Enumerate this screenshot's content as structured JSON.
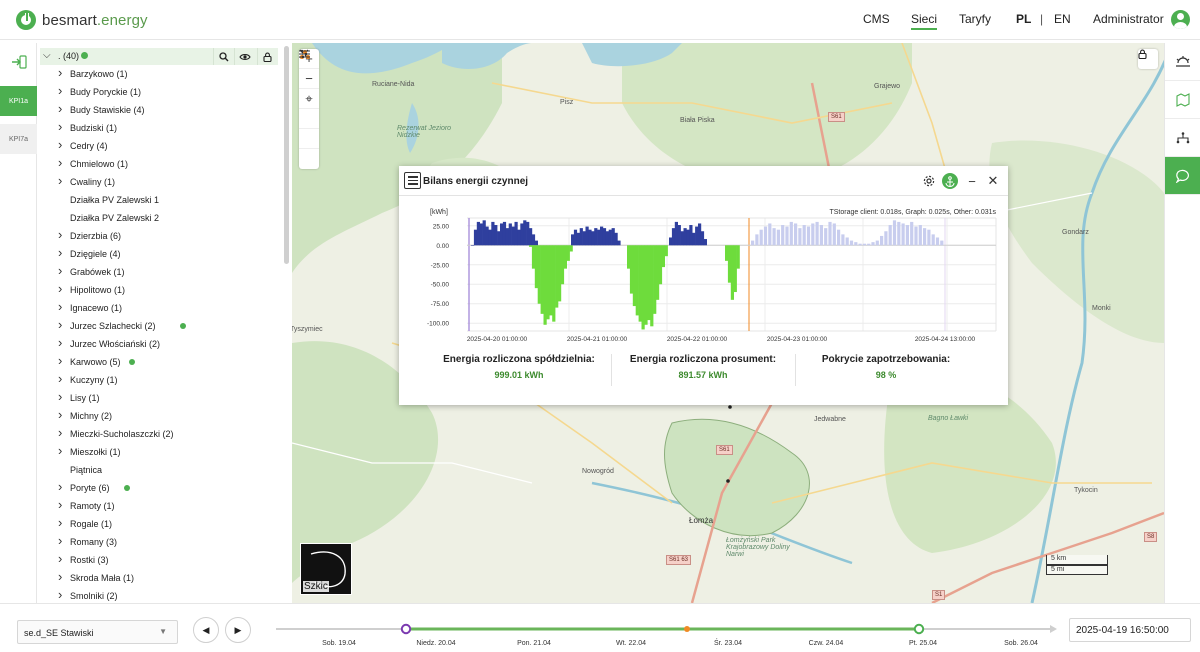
{
  "brand": {
    "part1": "besmart",
    "part2": ".energy"
  },
  "nav": {
    "cms": "CMS",
    "sieci": "Sieci",
    "taryfy": "Taryfy",
    "lang_pl": "PL",
    "sep": "|",
    "lang_en": "EN",
    "user": "Administrator"
  },
  "rail": {
    "kpi1": "KPI1a",
    "kpi2": "KPI7a"
  },
  "tree": {
    "root_label": ". (40)",
    "rows": [
      {
        "label": "Barzykowo (1)",
        "chev": true,
        "dot": false
      },
      {
        "label": "Budy Poryckie (1)",
        "chev": true,
        "dot": false
      },
      {
        "label": "Budy Stawiskie (4)",
        "chev": true,
        "dot": false
      },
      {
        "label": "Budziski (1)",
        "chev": true,
        "dot": false
      },
      {
        "label": "Cedry (4)",
        "chev": true,
        "dot": false
      },
      {
        "label": "Chmielowo (1)",
        "chev": true,
        "dot": false
      },
      {
        "label": "Cwaliny (1)",
        "chev": true,
        "dot": false
      },
      {
        "label": "Działka PV Zalewski 1",
        "chev": false,
        "dot": false
      },
      {
        "label": "Działka PV Zalewski 2",
        "chev": false,
        "dot": false
      },
      {
        "label": "Dzierzbia (6)",
        "chev": true,
        "dot": false
      },
      {
        "label": "Dzięgiele (4)",
        "chev": true,
        "dot": false
      },
      {
        "label": "Grabówek (1)",
        "chev": true,
        "dot": false
      },
      {
        "label": "Hipolitowo (1)",
        "chev": true,
        "dot": false
      },
      {
        "label": "Ignacewo (1)",
        "chev": true,
        "dot": false
      },
      {
        "label": "Jurzec Szlachecki (2)",
        "chev": true,
        "dot": true
      },
      {
        "label": "Jurzec Włościański (2)",
        "chev": true,
        "dot": false
      },
      {
        "label": "Karwowo (5)",
        "chev": true,
        "dot": true
      },
      {
        "label": "Kuczyny (1)",
        "chev": true,
        "dot": false
      },
      {
        "label": "Lisy (1)",
        "chev": true,
        "dot": false
      },
      {
        "label": "Michny (2)",
        "chev": true,
        "dot": false
      },
      {
        "label": "Mieczki-Sucholaszczki (2)",
        "chev": true,
        "dot": false
      },
      {
        "label": "Mieszołki (1)",
        "chev": true,
        "dot": false
      },
      {
        "label": "Piątnica",
        "chev": false,
        "dot": false
      },
      {
        "label": "Poryte (6)",
        "chev": true,
        "dot": true
      },
      {
        "label": "Ramoty (1)",
        "chev": true,
        "dot": false
      },
      {
        "label": "Rogale (1)",
        "chev": true,
        "dot": false
      },
      {
        "label": "Romany (3)",
        "chev": true,
        "dot": false
      },
      {
        "label": "Rostki (3)",
        "chev": true,
        "dot": false
      },
      {
        "label": "Skroda Mała (1)",
        "chev": true,
        "dot": false
      },
      {
        "label": "Smolniki (2)",
        "chev": true,
        "dot": false
      }
    ]
  },
  "map": {
    "labels": [
      {
        "t": "Ruciane-Nida",
        "x": 80,
        "y": 38,
        "cls": ""
      },
      {
        "t": "Pisz",
        "x": 268,
        "y": 56,
        "cls": ""
      },
      {
        "t": "Biała Piska",
        "x": 388,
        "y": 74,
        "cls": ""
      },
      {
        "t": "Grajewo",
        "x": 582,
        "y": 40,
        "cls": ""
      },
      {
        "t": "Rezerwat Jezioro Nidzkie",
        "x": 105,
        "y": 82,
        "cls": "italic"
      },
      {
        "t": "Gondarz",
        "x": 770,
        "y": 186,
        "cls": ""
      },
      {
        "t": "Monki",
        "x": 800,
        "y": 262,
        "cls": ""
      },
      {
        "t": "Tyszymiec",
        "x": -2,
        "y": 283,
        "cls": ""
      },
      {
        "t": "Jedwabne",
        "x": 522,
        "y": 373,
        "cls": ""
      },
      {
        "t": "Nowogród",
        "x": 290,
        "y": 425,
        "cls": ""
      },
      {
        "t": "Łomża",
        "x": 397,
        "y": 473,
        "cls": "map-city"
      },
      {
        "t": "Tykocin",
        "x": 782,
        "y": 444,
        "cls": ""
      },
      {
        "t": "Bagno Ławki",
        "x": 636,
        "y": 372,
        "cls": "italic"
      },
      {
        "t": "Łomżyński Park Krajobrazowy Doliny Narwi",
        "x": 434,
        "y": 494,
        "cls": "italic"
      }
    ],
    "roads": [
      {
        "t": "S61",
        "x": 536,
        "y": 69
      },
      {
        "t": "S61",
        "x": 424,
        "y": 402
      },
      {
        "t": "S61 63",
        "x": 374,
        "y": 512
      },
      {
        "t": "S8",
        "x": 852,
        "y": 489
      },
      {
        "t": "S1",
        "x": 640,
        "y": 547
      }
    ],
    "minimap_label": "Szkic",
    "scale_km": "5 km",
    "scale_mi": "5 mi"
  },
  "popup": {
    "title": "Bilans energii czynnej",
    "unit": "[kWh]",
    "timing": "TStorage client: 0.018s, Graph: 0.025s, Other: 0.031s",
    "stats": [
      {
        "label": "Energia rozliczona spółdzielnia:",
        "value": "999.01 kWh"
      },
      {
        "label": "Energia rozliczona prosument:",
        "value": "891.57 kWh"
      },
      {
        "label": "Pokrycie zapotrzebowania:",
        "value": "98 %"
      }
    ]
  },
  "chart_data": {
    "type": "bar",
    "title": "Bilans energii czynnej",
    "ylabel": "[kWh]",
    "ylim": [
      -110,
      35
    ],
    "yticks": [
      "25.00",
      "0.00",
      "-25.00",
      "-50.00",
      "-75.00",
      "-100.00"
    ],
    "ytick_values": [
      25,
      0,
      -25,
      -50,
      -75,
      -100
    ],
    "xticks": [
      "2025-04-20 01:00:00",
      "2025-04-21 01:00:00",
      "2025-04-22 01:00:00",
      "2025-04-23 01:00:00",
      "2025-04-24 13:00:00"
    ],
    "series": [
      {
        "name": "",
        "color": "#2f3f9e",
        "values": [
          0,
          20,
          30,
          28,
          32,
          24,
          20,
          30,
          26,
          18,
          28,
          30,
          22,
          28,
          24,
          30,
          20,
          28,
          32,
          30,
          22,
          14,
          6
        ]
      },
      {
        "name": "",
        "color": "#6edc3c",
        "values": [
          -2,
          -30,
          -55,
          -75,
          -88,
          -102,
          -95,
          -90,
          -98,
          -80,
          -72,
          -50,
          -30,
          -20,
          -8
        ]
      },
      {
        "name": "",
        "color": "#2f3f9e",
        "values": [
          14,
          20,
          16,
          22,
          18,
          24,
          20,
          18,
          22,
          20,
          24,
          22,
          18,
          20,
          22,
          16,
          6
        ]
      },
      {
        "name": "",
        "color": "#6edc3c",
        "values": [
          -30,
          -62,
          -78,
          -90,
          -98,
          -108,
          -102,
          -96,
          -104,
          -88,
          -70,
          -50,
          -28,
          -14
        ]
      },
      {
        "name": "",
        "color": "#2f3f9e",
        "values": [
          10,
          22,
          30,
          26,
          18,
          22,
          20,
          26,
          16,
          24,
          28,
          18,
          8
        ]
      },
      {
        "name": "",
        "color": "#6edc3c",
        "values": [
          -20,
          -48,
          -70,
          -60,
          -30
        ]
      },
      {
        "name": "",
        "color": "#c8cdee",
        "values": [
          6,
          14,
          20,
          24,
          28,
          22,
          20,
          26,
          24,
          30,
          28,
          22,
          26,
          24,
          28,
          30,
          26,
          22,
          30,
          28,
          20,
          14,
          10,
          6,
          4,
          2,
          2,
          2,
          4,
          6,
          12,
          18,
          26,
          32,
          30,
          28,
          26,
          30,
          24,
          26,
          22,
          20,
          14,
          10,
          6
        ]
      }
    ]
  },
  "timeline": {
    "select_value": "se.d_SE Stawiski",
    "labels": [
      "Sob. 19.04",
      "Niedz. 20.04",
      "Pon. 21.04",
      "Wt. 22.04",
      "Śr. 23.04",
      "Czw. 24.04",
      "Pt. 25.04",
      "Sob. 26.04"
    ],
    "datetime": "2025-04-19 16:50:00"
  }
}
